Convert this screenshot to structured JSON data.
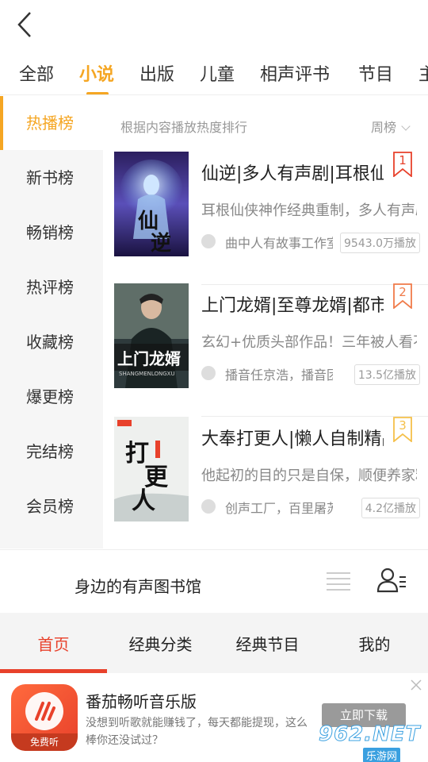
{
  "tabs": [
    "全部",
    "小说",
    "出版",
    "儿童",
    "相声评书",
    "节目",
    "主"
  ],
  "sidebar": [
    "热播榜",
    "新书榜",
    "畅销榜",
    "热评榜",
    "收藏榜",
    "爆更榜",
    "完结榜",
    "会员榜"
  ],
  "content": {
    "subtitle": "根据内容播放热度排行",
    "period": "周榜"
  },
  "books": [
    {
      "title": "仙逆|多人有声剧|耳根仙侠神作经典重制",
      "desc": "耳根仙侠神作经典重制，多人有声剧",
      "author": "曲中人有故事工作室",
      "plays": "9543.0万播放",
      "rank": "1",
      "rank_color": "#e8412b",
      "cover_text": "仙逆"
    },
    {
      "title": "上门龙婿|至尊龙婿|都市神豪",
      "desc": "玄幻+优质头部作品！三年被人看不起",
      "author": "播音任京浩，播音团队",
      "plays": "13.5亿播放",
      "rank": "2",
      "rank_color": "#f07b4a",
      "cover_text": "上门龙婿",
      "cover_sub": "SHANGMENLONGXU"
    },
    {
      "title": "大奉打更人|懒人自制精品",
      "desc": "他起初的目的只是自保，顺便养家糊口",
      "author": "创声工厂，百里屠苏",
      "plays": "4.2亿播放",
      "rank": "3",
      "rank_color": "#f5c04a",
      "cover_text": "打更人"
    }
  ],
  "footer": {
    "library_title": "身边的有声图书馆"
  },
  "bottom_nav": [
    "首页",
    "经典分类",
    "经典节目",
    "我的"
  ],
  "ad": {
    "title": "番茄畅听音乐版",
    "desc": "没想到听歌就能赚钱了，每天都能提现，这么棒你还没试过？",
    "button": "立即下载",
    "badge": "免费听",
    "watermark_main": "962.NET",
    "watermark_sub": "乐游网"
  },
  "colors": {
    "accent": "#f5a623",
    "nav_active": "#e8412b"
  }
}
